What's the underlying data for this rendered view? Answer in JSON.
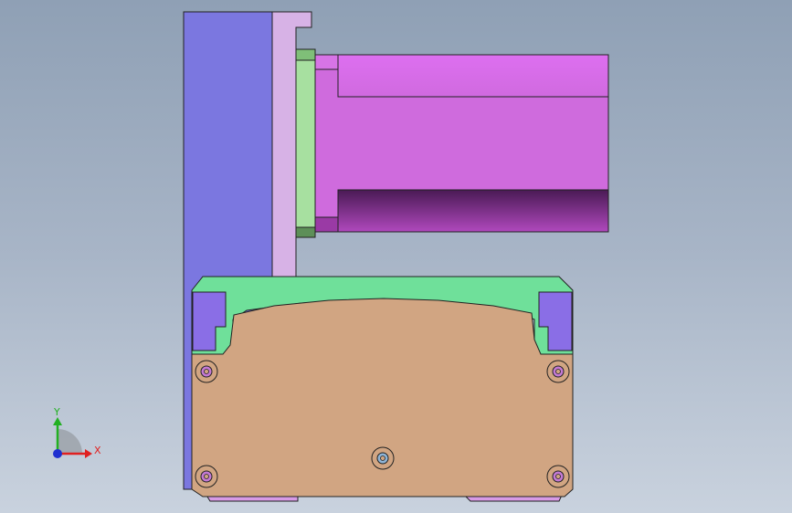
{
  "viewport": {
    "background_top": "#8fa0b5",
    "background_bottom": "#c9d2de"
  },
  "colors": {
    "back_plate": "#7b77e0",
    "mount_plate": "#d7b2e6",
    "motor_flange": "#a7e0a0",
    "motor_body": "#cf6bdd",
    "motor_top": "#d96fe8",
    "motor_bottom_dark": "#7b2a82",
    "rail_green": "#6fe09a",
    "carriage_body": "#d1a582",
    "block_side": "#8a6ee6",
    "bottom_strip": "#d79ae6",
    "outline": "#222222",
    "axis_x": "#e02020",
    "axis_y": "#22b022",
    "axis_z": "#2030d0"
  },
  "triad": {
    "x_label": "X",
    "y_label": "Y"
  }
}
